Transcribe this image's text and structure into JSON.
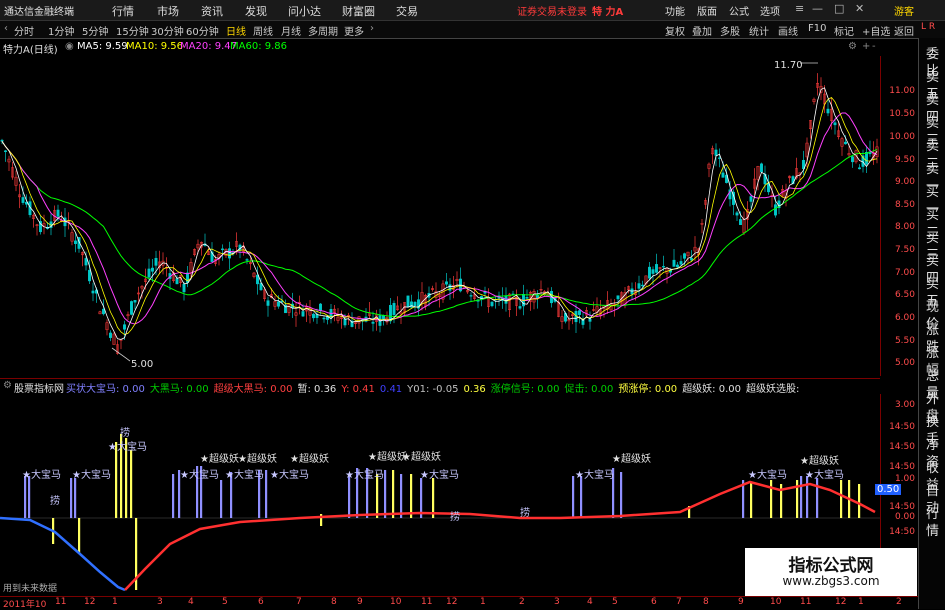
{
  "menubar": {
    "logo": "通达信金融终端",
    "menus": [
      "行情",
      "市场",
      "资讯",
      "发现",
      "问小达",
      "财富圈",
      "交易"
    ],
    "status": "证券交易未登录",
    "stock_name": "特 力A",
    "right_items": [
      "功能",
      "版面",
      "公式",
      "选项"
    ],
    "guest": "游客"
  },
  "toolbar": {
    "timeframes": [
      "分时",
      "1分钟",
      "5分钟",
      "15分钟",
      "30分钟",
      "60分钟",
      "日线",
      "周线",
      "月线",
      "多周期",
      "更多"
    ],
    "active": "日线",
    "right_items": [
      "复权",
      "叠加",
      "多股",
      "统计",
      "画线",
      "F10",
      "标记",
      "+自选",
      "返回"
    ]
  },
  "chart_header": {
    "title": "特力A(日线)",
    "ma5": "MA5: 9.59",
    "ma10": "MA10: 9.56",
    "ma20": "MA20: 9.47",
    "ma60": "MA60: 9.86"
  },
  "main_axis": [
    "11.00",
    "10.50",
    "10.00",
    "9.50",
    "9.00",
    "8.50",
    "8.00",
    "7.50",
    "7.00",
    "6.50",
    "6.00",
    "5.50",
    "5.00"
  ],
  "annotations": {
    "high": "11.70",
    "low": "5.00"
  },
  "indicator_header": {
    "name": "股票指标网",
    "items": [
      {
        "text": "买状大宝马: 0.00",
        "color": "#8080ff"
      },
      {
        "text": "大黑马: 0.00",
        "color": "#00d000"
      },
      {
        "text": "超级大黑马: 0.00",
        "color": "#ff4040"
      },
      {
        "text": "暂: 0.36",
        "color": "#e0e0e0"
      },
      {
        "text": "Y: 0.41",
        "color": "#ff4040"
      },
      {
        "text": "0.41",
        "color": "#4040ff"
      },
      {
        "text": "Y01: -0.05",
        "color": "#c0c0c0"
      },
      {
        "text": "0.36",
        "color": "#ffff40"
      },
      {
        "text": "涨停信号: 0.00",
        "color": "#00d000"
      },
      {
        "text": "促击: 0.00",
        "color": "#00d000"
      },
      {
        "text": "预涨停: 0.00",
        "color": "#ffff40"
      },
      {
        "text": "超级妖: 0.00",
        "color": "#e0e0e0"
      },
      {
        "text": "超级妖选股:",
        "color": "#e0e0e0"
      }
    ]
  },
  "ind_axis": [
    "3.00",
    "14:50",
    "14:50",
    "14:50",
    "1.00",
    "14:50",
    "0.00",
    "14:50"
  ],
  "ind_value": "0.50",
  "ind_labels": {
    "dbm": "★大宝马",
    "cjy": "★超级妖",
    "buy": "1",
    "drag": "捞",
    "future": "用到未来数据"
  },
  "sidebar": [
    "委比",
    "卖五",
    "卖四",
    "卖三",
    "卖二",
    "卖一",
    "买一",
    "买二",
    "买三",
    "买四",
    "买五",
    "现价",
    "涨跌",
    "涨幅",
    "总量",
    "外盘",
    "换手",
    "净资",
    "收益",
    "自动",
    "行情"
  ],
  "sidebar_top": "L R",
  "dates": [
    "2011年10",
    "11",
    "12",
    "1",
    "3",
    "4",
    "5",
    "6",
    "7",
    "8",
    "9",
    "10",
    "11",
    "12",
    "1",
    "2",
    "3",
    "4",
    "5",
    "6",
    "7",
    "8",
    "9",
    "10",
    "11",
    "12",
    "1",
    "2"
  ],
  "watermark": {
    "line1": "指标公式网",
    "line2": "www.zbgs3.com"
  },
  "colors": {
    "up": "#ff3b3b",
    "down": "#00c8c8",
    "ma5": "#ffffff",
    "ma10": "#ffff00",
    "ma20": "#ff40ff",
    "ma60": "#00ff00",
    "axis": "#ff4c4c"
  }
}
